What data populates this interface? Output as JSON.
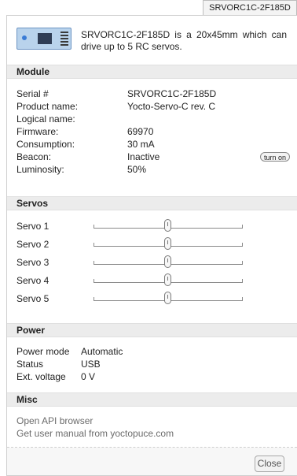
{
  "tab": {
    "label": "SRVORC1C-2F185D"
  },
  "header": {
    "description": "SRVORC1C-2F185D is a 20x45mm which can drive up to 5 RC servos."
  },
  "module": {
    "title": "Module",
    "rows": [
      {
        "label": "Serial #",
        "value": "SRVORC1C-2F185D"
      },
      {
        "label": "Product name:",
        "value": "Yocto-Servo-C rev. C"
      },
      {
        "label": "Logical name:",
        "value": ""
      },
      {
        "label": "Firmware:",
        "value": "69970"
      },
      {
        "label": "Consumption:",
        "value": "30 mA"
      },
      {
        "label": "Beacon:",
        "value": "Inactive"
      },
      {
        "label": "Luminosity:",
        "value": "50%"
      }
    ],
    "beacon_button": "turn on"
  },
  "servos": {
    "title": "Servos",
    "items": [
      {
        "label": "Servo 1",
        "position": 0.5
      },
      {
        "label": "Servo 2",
        "position": 0.5
      },
      {
        "label": "Servo 3",
        "position": 0.5
      },
      {
        "label": "Servo 4",
        "position": 0.5
      },
      {
        "label": "Servo 5",
        "position": 0.5
      }
    ]
  },
  "power": {
    "title": "Power",
    "rows": [
      {
        "label": "Power mode",
        "value": "Automatic"
      },
      {
        "label": "Status",
        "value": "USB"
      },
      {
        "label": "Ext. voltage",
        "value": "0 V"
      }
    ]
  },
  "misc": {
    "title": "Misc",
    "links": [
      "Open API browser",
      "Get user manual from yoctopuce.com"
    ]
  },
  "footer": {
    "close_label": "Close"
  }
}
